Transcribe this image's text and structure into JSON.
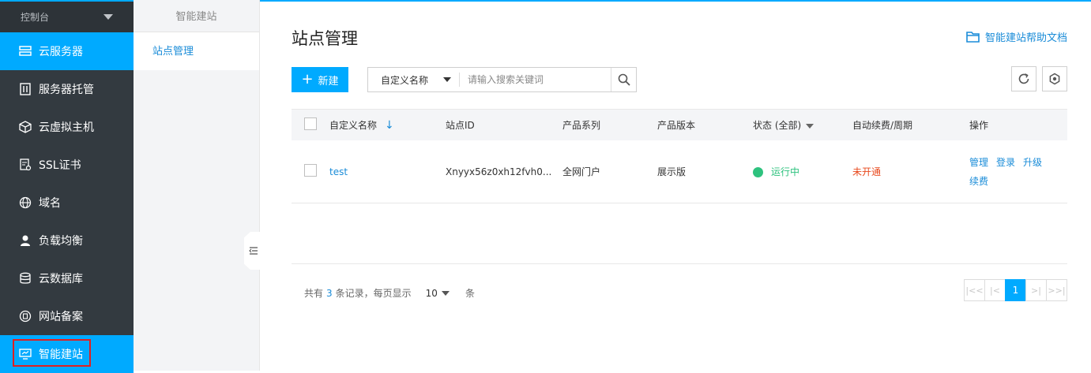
{
  "console": {
    "label": "控制台"
  },
  "sidebar": {
    "items": [
      {
        "label": "云服务器",
        "icon": "server-icon",
        "active": true
      },
      {
        "label": "服务器托管",
        "icon": "rack-icon"
      },
      {
        "label": "云虚拟主机",
        "icon": "cube-icon"
      },
      {
        "label": "SSL证书",
        "icon": "certificate-icon"
      },
      {
        "label": "域名",
        "icon": "globe-icon"
      },
      {
        "label": "负载均衡",
        "icon": "user-balance-icon"
      },
      {
        "label": "云数据库",
        "icon": "database-icon"
      },
      {
        "label": "网站备案",
        "icon": "record-icon"
      },
      {
        "label": "智能建站",
        "icon": "monitor-icon",
        "active": true,
        "highlighted": true
      }
    ]
  },
  "subnav": {
    "title": "智能建站",
    "items": [
      {
        "label": "站点管理"
      }
    ]
  },
  "page": {
    "title": "站点管理",
    "help_link": "智能建站帮助文档"
  },
  "toolbar": {
    "new_label": "新建",
    "search_field": "自定义名称",
    "search_placeholder": "请输入搜索关键词"
  },
  "table": {
    "headers": [
      "自定义名称",
      "站点ID",
      "产品系列",
      "产品版本",
      "状态 (全部)",
      "自动续费/周期",
      "操作"
    ],
    "rows": [
      {
        "name": "test",
        "site_id": "Xnyyx56z0xh12fvh0...",
        "series": "全网门户",
        "version": "展示版",
        "status": "运行中",
        "renew": "未开通",
        "actions": [
          "管理",
          "登录",
          "升级",
          "续费"
        ]
      }
    ]
  },
  "pagination": {
    "prefix": "共有",
    "total": "3",
    "mid": "条记录，每页显示",
    "page_size": "10",
    "unit": "条",
    "current_page": "1"
  },
  "colors": {
    "accent": "#00aaff",
    "sidebar_bg": "#333a40",
    "link": "#1a8cd8",
    "running": "#2ec27e",
    "warning": "#e84a1e"
  }
}
